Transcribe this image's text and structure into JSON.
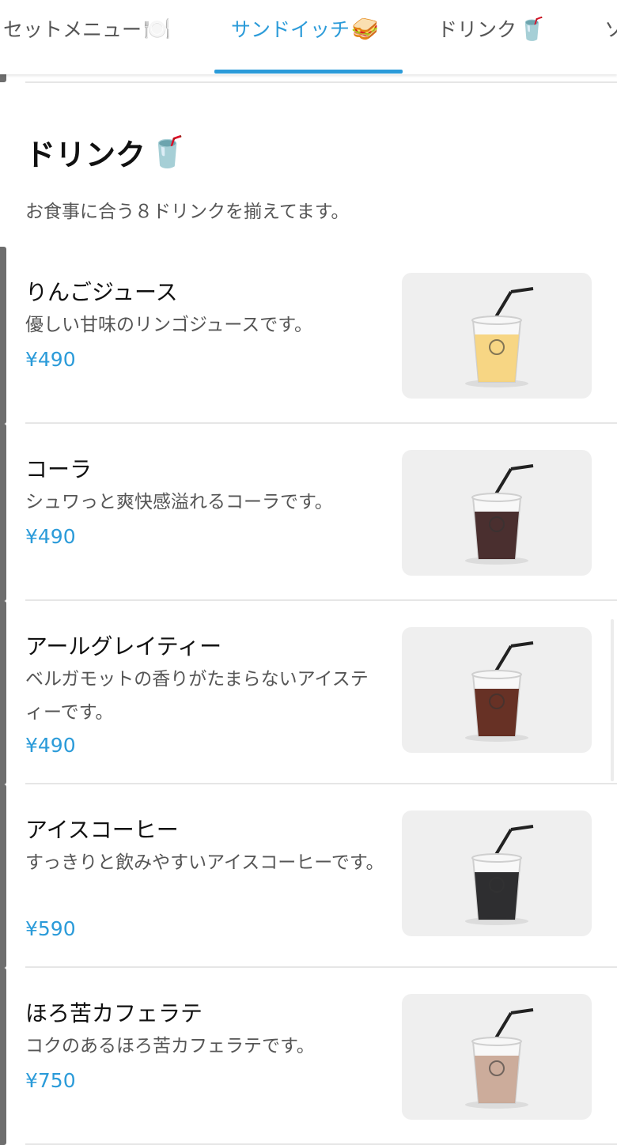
{
  "tabs": [
    {
      "label": "セットメニュー",
      "emoji": "🍽️"
    },
    {
      "label": "サンドイッチ",
      "emoji": "🥪"
    },
    {
      "label": "ドリンク",
      "emoji": "🥤"
    },
    {
      "label": "ソ",
      "emoji": ""
    }
  ],
  "active_tab": 1,
  "section": {
    "title": "ドリンク",
    "emoji": "🥤",
    "description": "お食事に合う８ドリンクを揃えてます。"
  },
  "items": [
    {
      "name": "りんごジュース",
      "description": "優しい甘味のリンゴジュースです。",
      "price": "¥490",
      "drink_color": "#f6d27a"
    },
    {
      "name": "コーラ",
      "description": "シュワっと爽快感溢れるコーラです。",
      "price": "¥490",
      "drink_color": "#3b1d1d"
    },
    {
      "name": "アールグレイティー",
      "description": "ベルガモットの香りがたまらないアイスティーです。",
      "price": "¥490",
      "drink_color": "#5a1f12"
    },
    {
      "name": "アイスコーヒー",
      "description": "すっきりと飲みやすいアイスコーヒーです。",
      "price": "¥590",
      "drink_color": "#1c1c1e"
    },
    {
      "name": "ほろ苦カフェラテ",
      "description": "コクのあるほろ苦カフェラテです。",
      "price": "¥750",
      "drink_color": "#c8a593"
    }
  ],
  "colors": {
    "accent": "#2b9bd9",
    "text": "#111111",
    "muted": "#555555"
  }
}
